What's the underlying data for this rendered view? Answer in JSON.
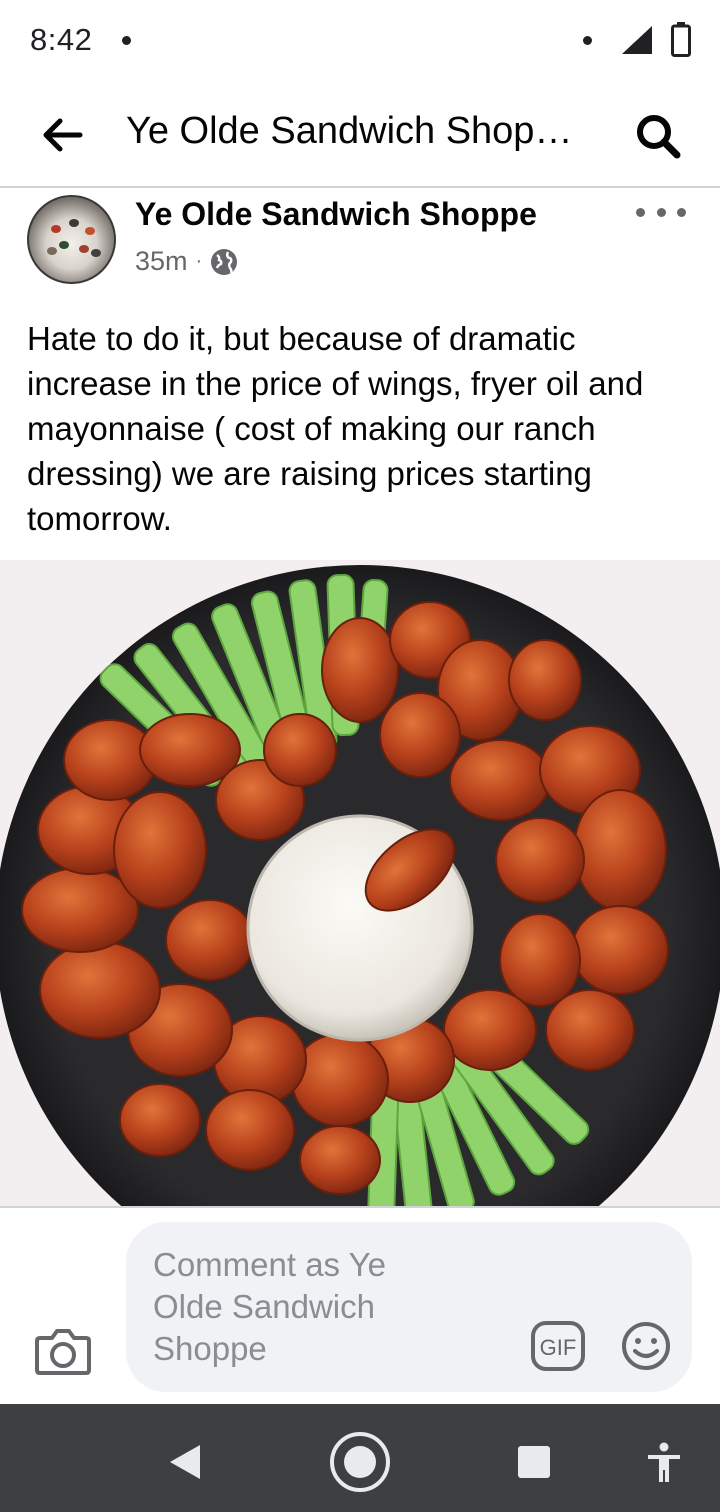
{
  "status_bar": {
    "time": "8:42"
  },
  "header": {
    "title": "Ye Olde Sandwich Shop…",
    "back_icon": "arrow-left-icon",
    "search_icon": "search-icon"
  },
  "post": {
    "page_name": "Ye Olde Sandwich Shoppe",
    "time_ago": "35m",
    "separator": "·",
    "audience_icon": "globe-icon",
    "more_icon": "more-horizontal-icon",
    "text": "Hate to do it, but because of dramatic increase in the price of wings, fryer oil and mayonnaise ( cost of making our ranch dressing) we are raising prices starting tomorrow.",
    "image_icon": "wings-platter-photo"
  },
  "comment": {
    "placeholder": "Comment as Ye Olde Sandwich Shoppe",
    "gif_label": "GIF",
    "camera_icon": "camera-icon",
    "emoji_icon": "smiley-icon"
  },
  "nav": {
    "back_icon": "nav-back-triangle-icon",
    "home_icon": "nav-home-circle-icon",
    "recents_icon": "nav-recents-square-icon",
    "accessibility_icon": "accessibility-icon"
  },
  "colors": {
    "text_primary": "#050505",
    "text_secondary": "#65676b",
    "comment_bg": "#f0f2f5",
    "nav_bg": "#3c4043"
  }
}
